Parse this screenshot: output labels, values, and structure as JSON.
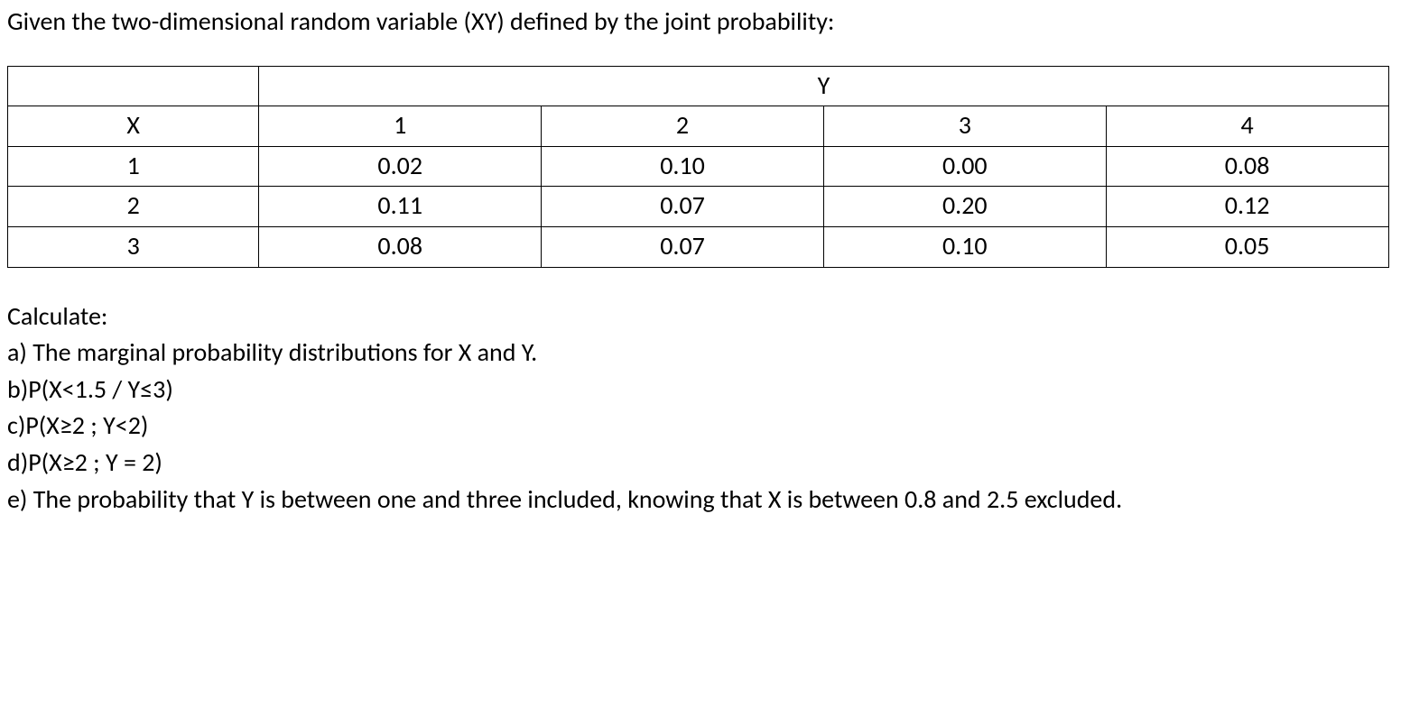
{
  "intro_text": "Given the two-dimensional random variable (XY) defined by the joint probability:",
  "table": {
    "y_header": "Y",
    "x_header": "X",
    "y_values": [
      "1",
      "2",
      "3",
      "4"
    ],
    "rows": [
      {
        "x": "1",
        "cells": [
          "0.02",
          "0.10",
          "0.00",
          "0.08"
        ]
      },
      {
        "x": "2",
        "cells": [
          "0.11",
          "0.07",
          "0.20",
          "0.12"
        ]
      },
      {
        "x": "3",
        "cells": [
          "0.08",
          "0.07",
          "0.10",
          "0.05"
        ]
      }
    ]
  },
  "calculate_label": "Calculate:",
  "questions": {
    "a": "a) The marginal probability distributions for X and Y.",
    "b": "b)P(X<1.5 / Y≤3)",
    "c": "c)P(X≥2 ; Y<2)",
    "d": "d)P(X≥2 ; Y = 2)",
    "e": "e) The probability that Y is between one and three included, knowing that X is between 0.8 and 2.5 excluded."
  },
  "chart_data": {
    "type": "table",
    "title": "Joint probability P(X,Y)",
    "xlabel": "X",
    "ylabel": "Y",
    "x": [
      1,
      2,
      3
    ],
    "y": [
      1,
      2,
      3,
      4
    ],
    "matrix": [
      [
        0.02,
        0.1,
        0.0,
        0.08
      ],
      [
        0.11,
        0.07,
        0.2,
        0.12
      ],
      [
        0.08,
        0.07,
        0.1,
        0.05
      ]
    ]
  }
}
